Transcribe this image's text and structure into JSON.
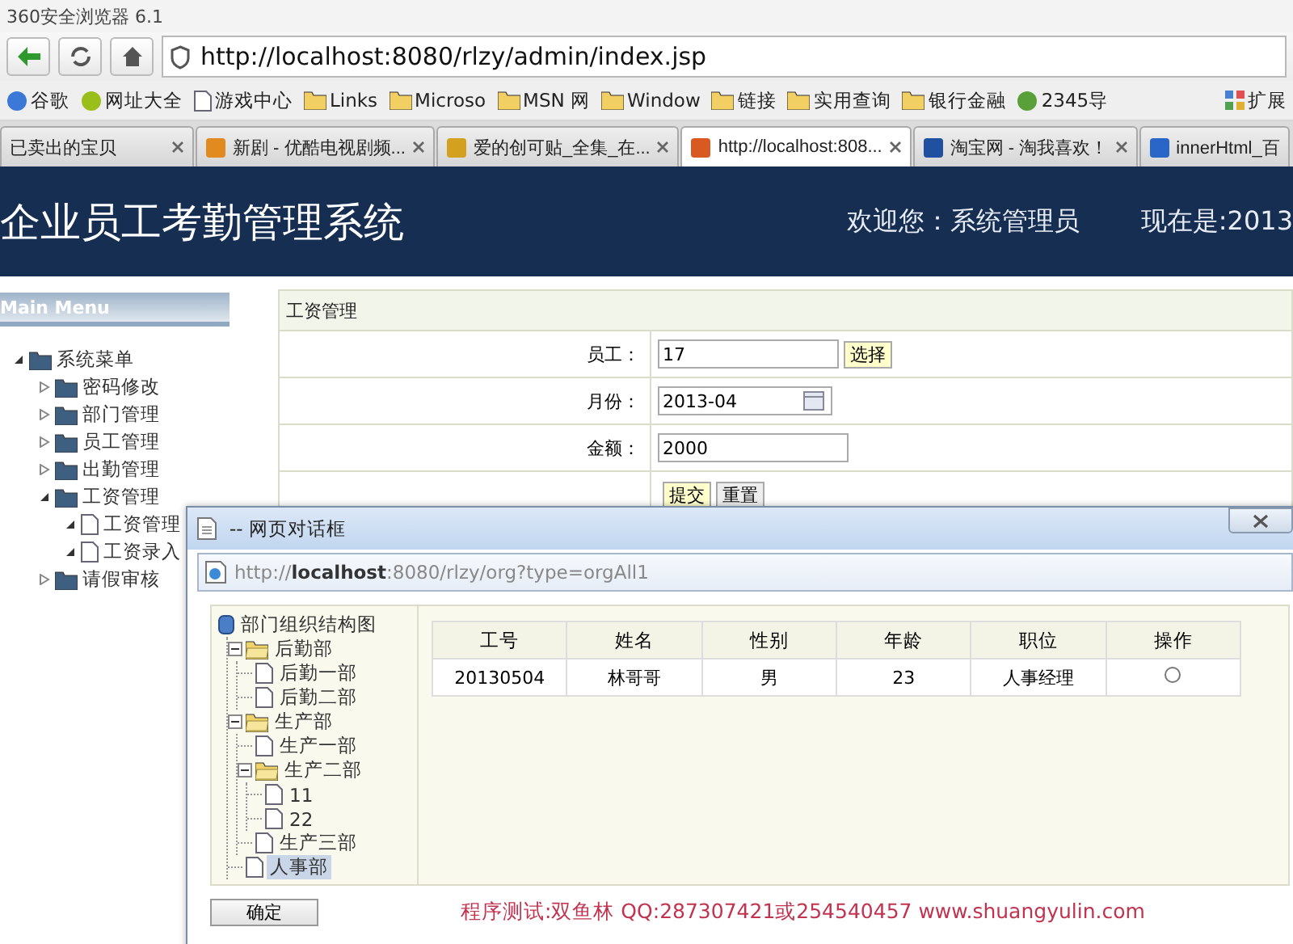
{
  "browser": {
    "title": "360安全浏览器 6.1",
    "url": "http://localhost:8080/rlzy/admin/index.jsp",
    "bookmarks": [
      {
        "label": "谷歌",
        "kind": "site"
      },
      {
        "label": "网址大全",
        "kind": "site"
      },
      {
        "label": "游戏中心",
        "kind": "page"
      },
      {
        "label": "Links",
        "kind": "folder"
      },
      {
        "label": "Microso",
        "kind": "folder"
      },
      {
        "label": "MSN 网",
        "kind": "folder"
      },
      {
        "label": "Window",
        "kind": "folder"
      },
      {
        "label": "链接",
        "kind": "folder"
      },
      {
        "label": "实用查询",
        "kind": "folder"
      },
      {
        "label": "银行金融",
        "kind": "folder"
      },
      {
        "label": "2345导",
        "kind": "site"
      }
    ],
    "extensions_label": "扩展",
    "tabs": [
      {
        "label": "已卖出的宝贝",
        "selected": false,
        "has_icon": false
      },
      {
        "label": "新剧 - 优酷电视剧频...",
        "selected": false,
        "has_icon": true
      },
      {
        "label": "爱的创可贴_全集_在...",
        "selected": false,
        "has_icon": true
      },
      {
        "label": "http://localhost:808...",
        "selected": true,
        "has_icon": true
      },
      {
        "label": "淘宝网 - 淘我喜欢！",
        "selected": false,
        "has_icon": true
      },
      {
        "label": "innerHtml_百",
        "selected": false,
        "has_icon": true
      }
    ]
  },
  "app": {
    "title": "企业员工考勤管理系统",
    "welcome": "欢迎您：系统管理员",
    "clock": "现在是:2013",
    "menu_title": "Main Menu",
    "menu": [
      {
        "label": "系统菜单",
        "kind": "folder",
        "expanded": true,
        "children": [
          {
            "label": "密码修改",
            "kind": "folder",
            "expanded": false
          },
          {
            "label": "部门管理",
            "kind": "folder",
            "expanded": false
          },
          {
            "label": "员工管理",
            "kind": "folder",
            "expanded": false
          },
          {
            "label": "出勤管理",
            "kind": "folder",
            "expanded": false
          },
          {
            "label": "工资管理",
            "kind": "folder",
            "expanded": true,
            "children": [
              {
                "label": "工资管理",
                "kind": "page",
                "expanded": true
              },
              {
                "label": "工资录入",
                "kind": "page",
                "expanded": true
              }
            ]
          },
          {
            "label": "请假审核",
            "kind": "folder",
            "expanded": false
          }
        ]
      }
    ],
    "form": {
      "title": "工资管理",
      "fields": [
        {
          "label": "员工：",
          "value": "17",
          "kind": "pick",
          "button": "选择"
        },
        {
          "label": "月份：",
          "value": "2013-04",
          "kind": "date"
        },
        {
          "label": "金额：",
          "value": "2000",
          "kind": "text"
        }
      ],
      "buttons": [
        {
          "label": "提交",
          "highlighted": true
        },
        {
          "label": "重置",
          "highlighted": false
        }
      ]
    }
  },
  "dialog": {
    "title": "-- 网页对话框",
    "url": "http://**localhost**:8080/rlzy/org?type=orgAll1",
    "tree": {
      "label": "部门组织结构图",
      "kind": "root",
      "selected": false,
      "children": [
        {
          "label": "后勤部",
          "kind": "folder",
          "expanded": true,
          "selected": false,
          "children": [
            {
              "label": "后勤一部",
              "kind": "page",
              "selected": false
            },
            {
              "label": "后勤二部",
              "kind": "page",
              "selected": false
            }
          ]
        },
        {
          "label": "生产部",
          "kind": "folder",
          "expanded": true,
          "selected": false,
          "children": [
            {
              "label": "生产一部",
              "kind": "page",
              "selected": false
            },
            {
              "label": "生产二部",
              "kind": "folder",
              "expanded": true,
              "selected": false,
              "children": [
                {
                  "label": "11",
                  "kind": "page",
                  "selected": false
                },
                {
                  "label": "22",
                  "kind": "page",
                  "selected": false
                }
              ]
            },
            {
              "label": "生产三部",
              "kind": "page",
              "selected": false
            }
          ]
        },
        {
          "label": "人事部",
          "kind": "page",
          "selected": true
        }
      ]
    },
    "columns": [
      "工号",
      "姓名",
      "性别",
      "年龄",
      "职位",
      "操作"
    ],
    "rows": [
      {
        "cells": [
          "20130504",
          "林哥哥",
          "男",
          "23",
          "人事经理"
        ],
        "selected": false
      }
    ],
    "ok_button": "确定",
    "footer": "程序测试:双鱼林 QQ:287307421或254540457 www.shuangyulin.com"
  }
}
